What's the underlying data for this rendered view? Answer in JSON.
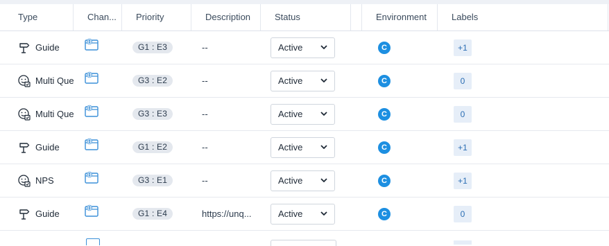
{
  "header": {
    "type": "Type",
    "channel": "Chan...",
    "priority": "Priority",
    "description": "Description",
    "status": "Status",
    "environment": "Environment",
    "labels": "Labels"
  },
  "rows": [
    {
      "type": "Guide",
      "type_icon": "signpost-icon",
      "channel_icon": "web-icon",
      "priority": "G1 : E3",
      "description": "--",
      "status": "Active",
      "environment": "C",
      "labels": "+1"
    },
    {
      "type": "Multi Que",
      "type_icon": "survey-icon",
      "channel_icon": "web-icon",
      "priority": "G3 : E2",
      "description": "--",
      "status": "Active",
      "environment": "C",
      "labels": "0"
    },
    {
      "type": "Multi Que",
      "type_icon": "survey-icon",
      "channel_icon": "web-icon",
      "priority": "G3 : E3",
      "description": "--",
      "status": "Active",
      "environment": "C",
      "labels": "0"
    },
    {
      "type": "Guide",
      "type_icon": "signpost-icon",
      "channel_icon": "web-icon",
      "priority": "G1 : E2",
      "description": "--",
      "status": "Active",
      "environment": "C",
      "labels": "+1"
    },
    {
      "type": "NPS",
      "type_icon": "survey-icon",
      "channel_icon": "web-icon",
      "priority": "G3 : E1",
      "description": "--",
      "status": "Active",
      "environment": "C",
      "labels": "+1"
    },
    {
      "type": "Guide",
      "type_icon": "signpost-icon",
      "channel_icon": "web-icon",
      "priority": "G1 : E4",
      "description": "https://unq...",
      "status": "Active",
      "environment": "C",
      "labels": "0"
    }
  ]
}
